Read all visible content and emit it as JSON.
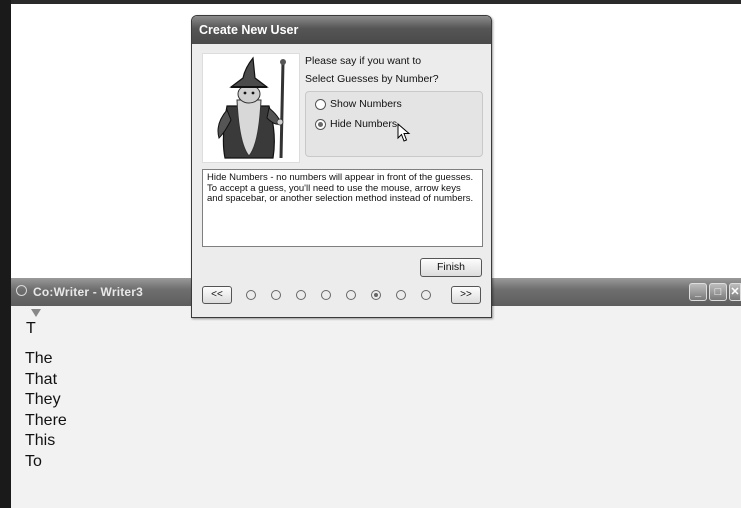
{
  "cowriter": {
    "title": "Co:Writer - Writer3",
    "typed_text": "T",
    "predictions": [
      "The",
      "That",
      "They",
      "There",
      "This",
      "To"
    ],
    "minimize_glyph": "_",
    "maximize_glyph": "□",
    "close_glyph": "✕"
  },
  "dialog": {
    "title": "Create New User",
    "prompt_line1": "Please say if you want to",
    "prompt_line2": "Select Guesses by Number?",
    "options": [
      {
        "label": "Show Numbers",
        "selected": false
      },
      {
        "label": "Hide Numbers",
        "selected": true
      }
    ],
    "description": "Hide Numbers - no numbers will appear in front of the guesses. To accept a guess, you'll need to use the mouse, arrow keys and spacebar, or another selection method instead of numbers.",
    "finish_label": "Finish",
    "prev_label": "<<",
    "next_label": ">>",
    "page_count": 8,
    "current_page": 6
  },
  "icons": [
    "wizard-illustration",
    "mouse-cursor-icon",
    "cowriter-app-icon"
  ]
}
